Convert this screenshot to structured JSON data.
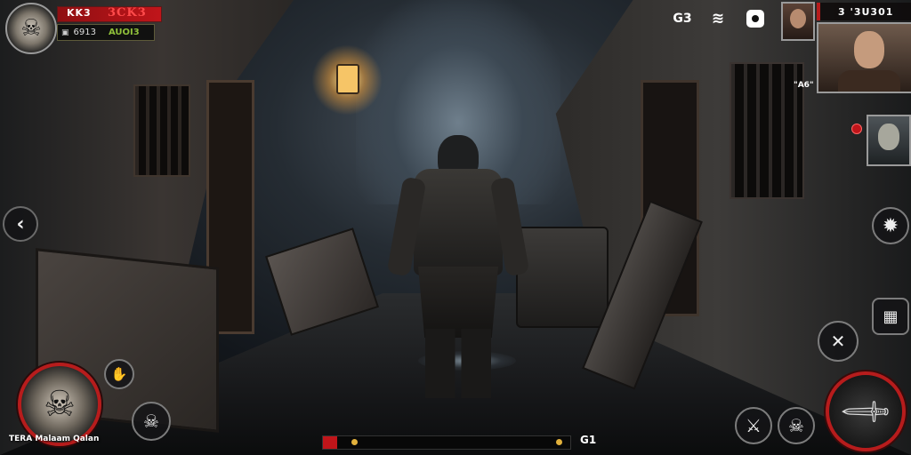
{
  "player": {
    "name_tag": "KK3",
    "health_text": "3CK3",
    "stat_left": "6913",
    "stat_right": "AUOI3"
  },
  "character_label": "TERA Malaam Qalan",
  "top_right": {
    "counter_text": "3 '3U301",
    "portrait_caption": "\"A6\"",
    "settings_symbol": "G3"
  },
  "bottom_bar": {
    "right_text": "G1"
  },
  "colors": {
    "health_red": "#c0151a",
    "hud_dark": "#141416",
    "accent_red": "#b71c1c",
    "stat_green": "#8fbf3a"
  },
  "icons": {
    "back": "chevron-left-icon",
    "gear": "gear-icon",
    "skull": "skull-icon",
    "sword": "sword-icon",
    "crossed_tools": "crossed-tools-icon",
    "map": "map-icon",
    "signal": "signal-icon",
    "hand": "hand-icon"
  }
}
